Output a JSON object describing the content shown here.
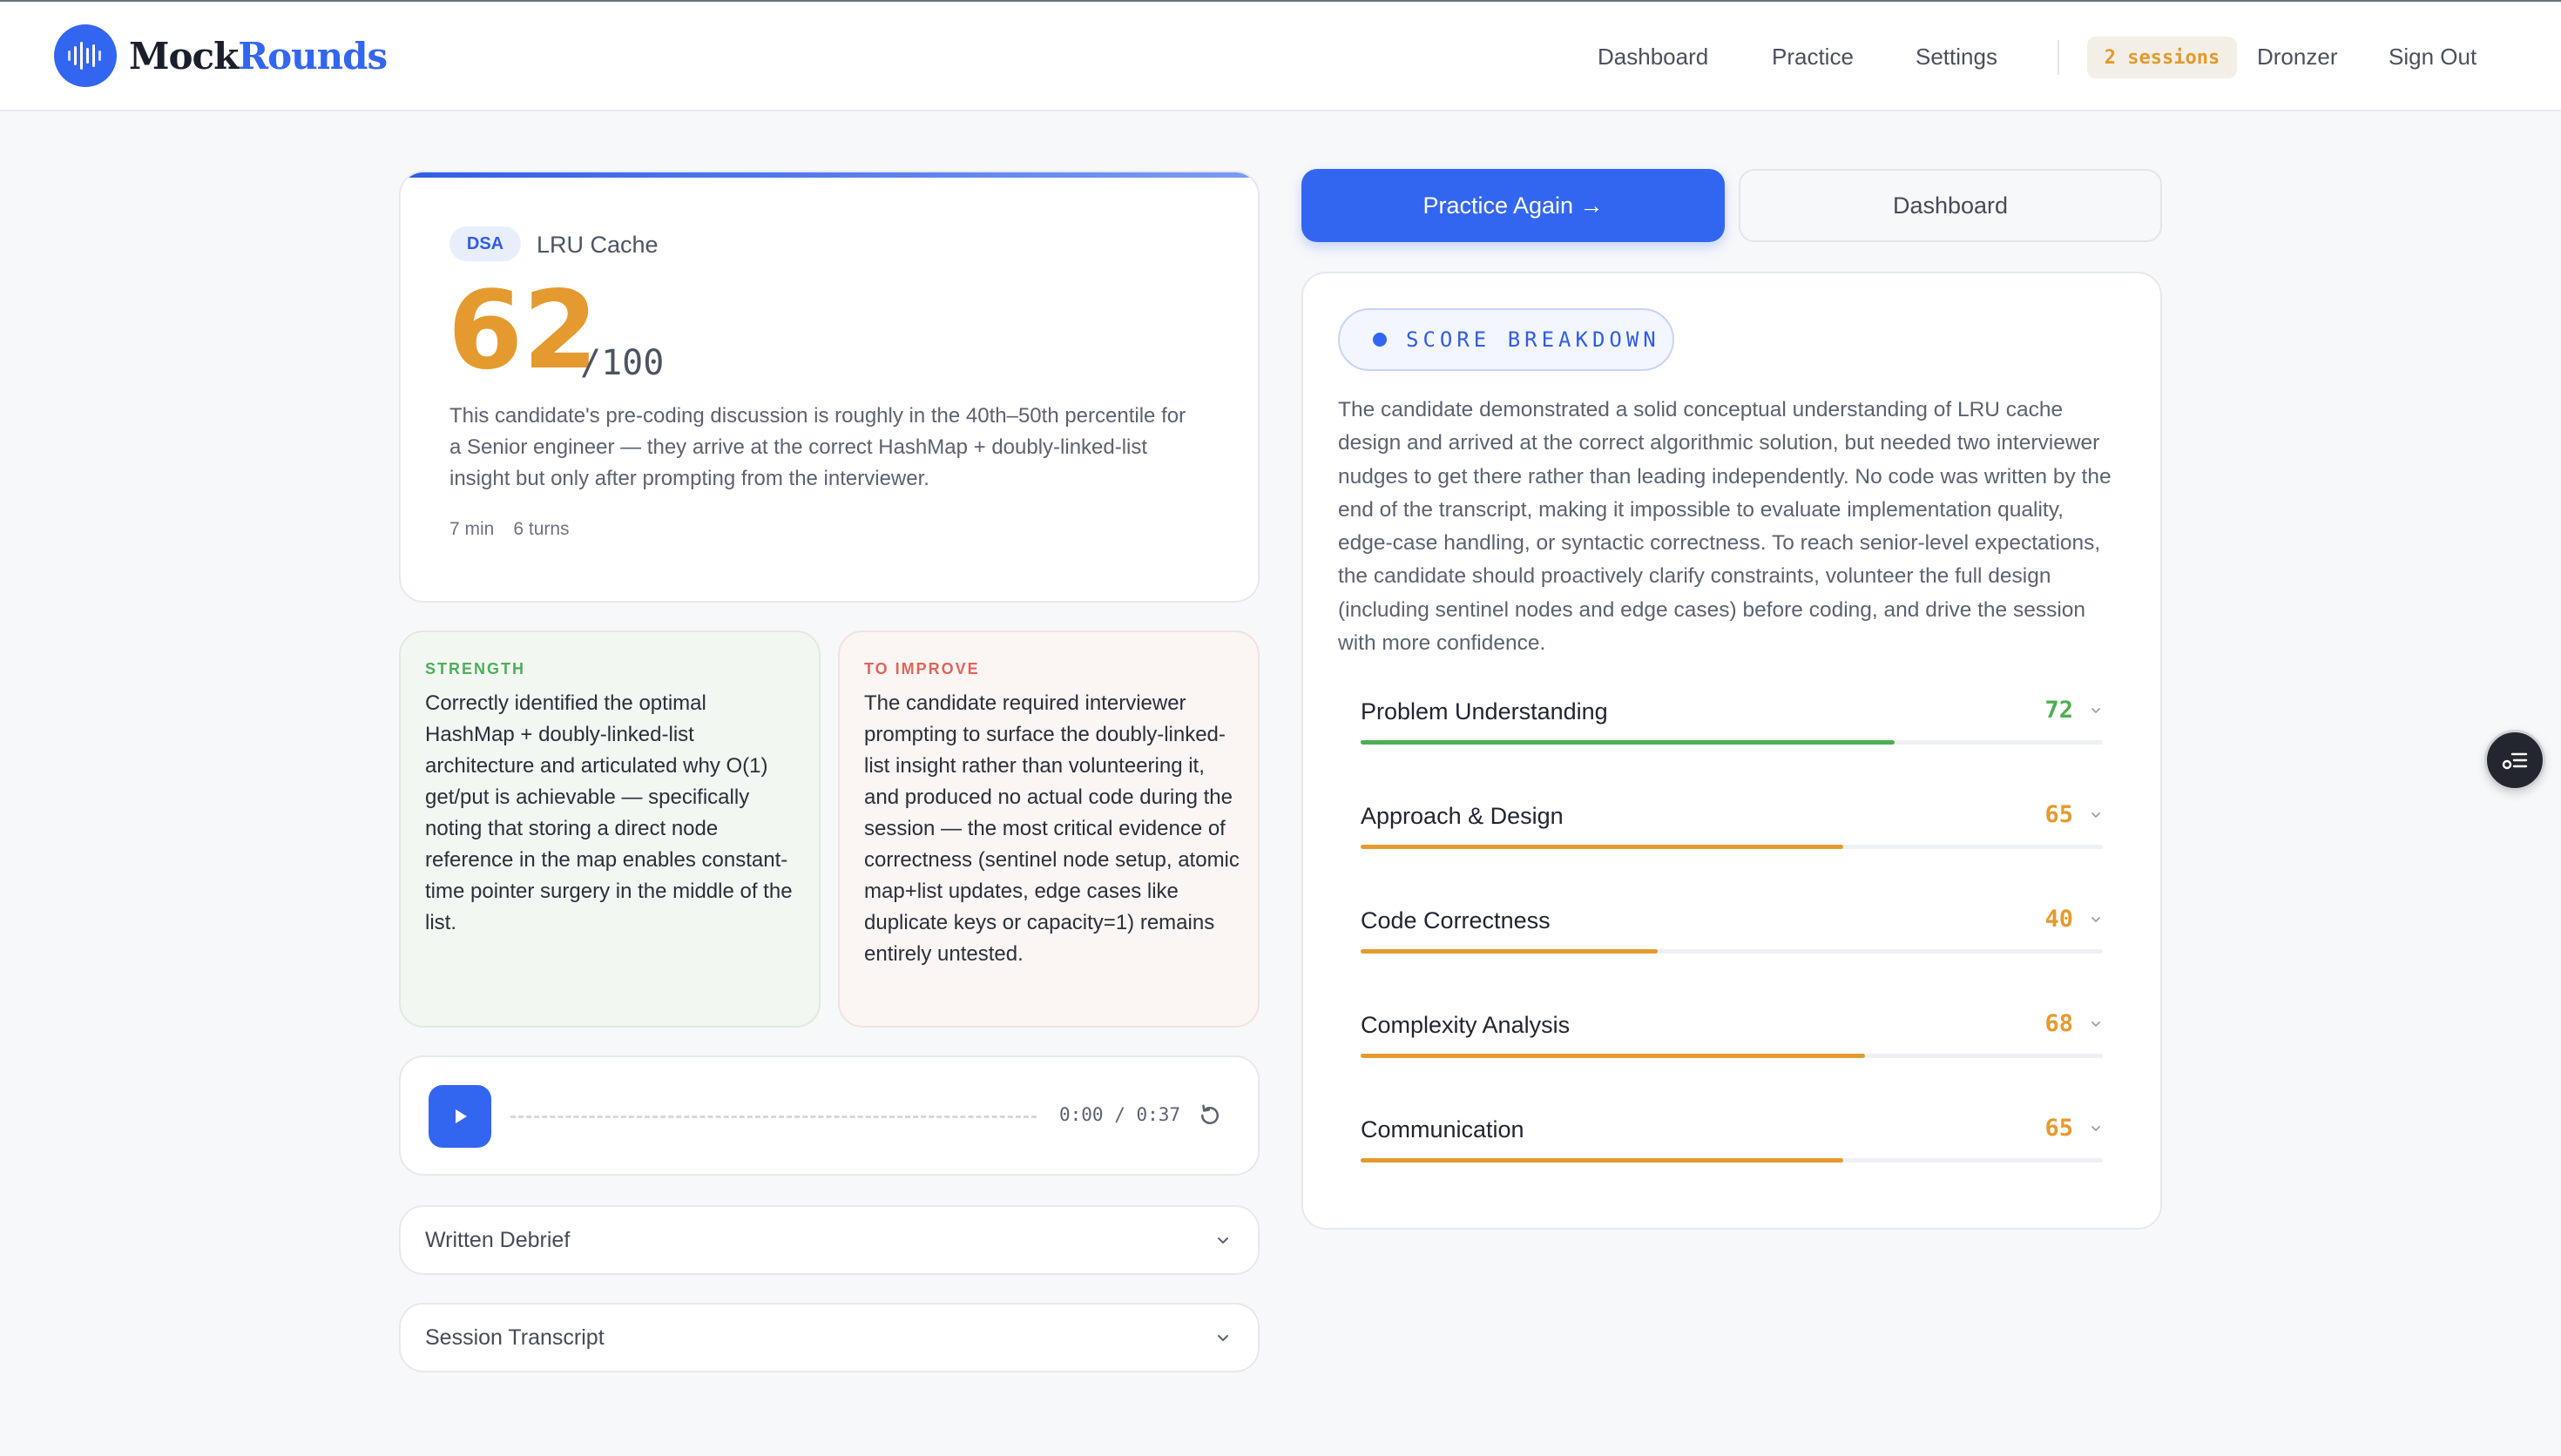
{
  "brand": {
    "name_part1": "Mock",
    "name_part2": "Rounds"
  },
  "nav": {
    "items": [
      "Dashboard",
      "Practice",
      "Settings"
    ],
    "sessions_badge": "2 sessions",
    "username": "Dronzer",
    "sign_out": "Sign Out"
  },
  "score_card": {
    "tag": "DSA",
    "problem": "LRU Cache",
    "score": "62",
    "out_of": "/100",
    "description": "This candidate's pre-coding discussion is roughly in the 40th–50th percentile for a Senior engineer — they arrive at the correct HashMap + doubly-linked-list insight but only after prompting from the interviewer.",
    "duration": "7 min",
    "turns": "6 turns"
  },
  "strength": {
    "label": "STRENGTH",
    "text": "Correctly identified the optimal HashMap + doubly-linked-list architecture and articulated why O(1) get/put is achievable — specifically noting that storing a direct node reference in the map enables constant-time pointer surgery in the middle of the list."
  },
  "improve": {
    "label": "TO IMPROVE",
    "text": "The candidate required interviewer prompting to surface the doubly-linked-list insight rather than volunteering it, and produced no actual code during the session — the most critical evidence of correctness (sentinel node setup, atomic map+list updates, edge cases like duplicate keys or capacity=1) remains entirely untested."
  },
  "audio": {
    "time": "0:00 / 0:37"
  },
  "accordions": {
    "debrief": "Written Debrief",
    "transcript": "Session Transcript"
  },
  "actions": {
    "practice_again": "Practice Again →",
    "dashboard": "Dashboard"
  },
  "breakdown": {
    "label": "SCORE BREAKDOWN",
    "summary": "The candidate demonstrated a solid conceptual understanding of LRU cache design and arrived at the correct algorithmic solution, but needed two interviewer nudges to get there rather than leading independently. No code was written by the end of the transcript, making it impossible to evaluate implementation quality, edge-case handling, or syntactic correctness. To reach senior-level expectations, the candidate should proactively clarify constraints, volunteer the full design (including sentinel nodes and edge cases) before coding, and drive the session with more confidence.",
    "metrics": [
      {
        "name": "Problem Understanding",
        "value": "72",
        "percent": 72,
        "color": "#4caf50"
      },
      {
        "name": "Approach & Design",
        "value": "65",
        "percent": 65,
        "color": "#e59a2f"
      },
      {
        "name": "Code Correctness",
        "value": "40",
        "percent": 40,
        "color": "#e59a2f"
      },
      {
        "name": "Complexity Analysis",
        "value": "68",
        "percent": 68,
        "color": "#e59a2f"
      },
      {
        "name": "Communication",
        "value": "65",
        "percent": 65,
        "color": "#e59a2f"
      }
    ]
  },
  "icons": {
    "logo": "waveform-icon",
    "play": "play-icon",
    "replay": "replay-icon",
    "chevron": "chevron-down-icon",
    "floating": "menu-settings-icon"
  },
  "colors": {
    "accent": "#3366f0",
    "score": "#e59a2f",
    "strength": "#4caf50",
    "improve": "#e0645a"
  }
}
